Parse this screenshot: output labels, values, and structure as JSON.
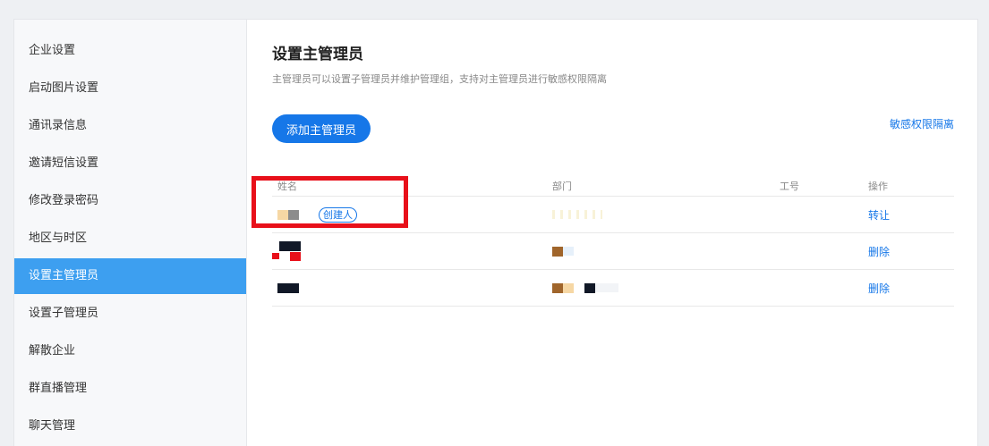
{
  "sidebar": {
    "items": [
      {
        "label": "企业设置"
      },
      {
        "label": "启动图片设置"
      },
      {
        "label": "通讯录信息"
      },
      {
        "label": "邀请短信设置"
      },
      {
        "label": "修改登录密码"
      },
      {
        "label": "地区与时区"
      },
      {
        "label": "设置主管理员",
        "active": true
      },
      {
        "label": "设置子管理员"
      },
      {
        "label": "解散企业"
      },
      {
        "label": "群直播管理"
      },
      {
        "label": "聊天管理"
      }
    ]
  },
  "main": {
    "title": "设置主管理员",
    "description": "主管理员可以设置子管理员并维护管理组，支持对主管理员进行敏感权限隔离",
    "add_button": "添加主管理员",
    "isolation_link": "敏感权限隔离",
    "table": {
      "headers": {
        "name": "姓名",
        "dept": "部门",
        "employee_no": "工号",
        "actions": "操作"
      },
      "rows": [
        {
          "badge": "创建人",
          "action": "转让"
        },
        {
          "action": "删除"
        },
        {
          "action": "删除"
        }
      ]
    }
  },
  "colors": {
    "accent": "#1677e8",
    "active_bg": "#3d9ff0",
    "highlight": "#e8101a"
  }
}
